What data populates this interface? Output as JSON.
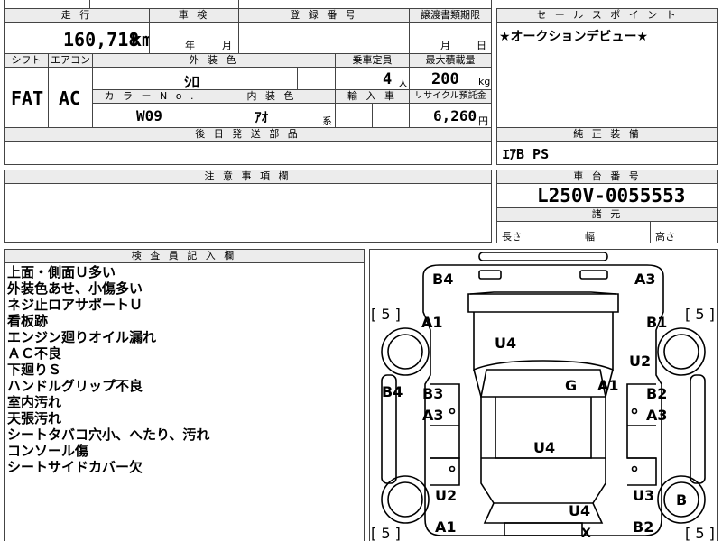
{
  "header": {
    "mileage_label": "走 行",
    "inspection_label": "車 検",
    "registration_label": "登 録 番 号",
    "transfer_docs_label": "譲渡書類期限",
    "sales_point_label": "セ ー ル ス ポ イ ン ト"
  },
  "mileage": {
    "value": "160,718",
    "unit": "km"
  },
  "inspection": {
    "year_label": "年",
    "month_label": "月"
  },
  "transfer": {
    "month_label": "月",
    "day_label": "日"
  },
  "sales_point": {
    "text": "★オークションデビュー★"
  },
  "labels": {
    "shift": "シフト",
    "aircon": "エアコン",
    "exterior_color": "外 装 色",
    "capacity": "乗車定員",
    "max_load": "最大積載量",
    "color_no": "カ ラ ー N o .",
    "interior_color": "内 装 色",
    "import": "輸 入 車",
    "recycle": "リサイクル預託金",
    "later_parts": "後 日 発 送 部 品",
    "oem_equipment": "純 正 装 備",
    "notes": "注 意 事 項 欄",
    "chassis_no": "車 台 番 号",
    "dimensions": "諸 元",
    "length": "長さ",
    "width": "幅",
    "height": "高さ",
    "inspector_notes": "検 査 員 記 入 欄"
  },
  "vehicle": {
    "shift": "FAT",
    "aircon": "AC",
    "exterior_color": "ｼﾛ",
    "capacity": "4",
    "capacity_unit": "人",
    "max_load": "200",
    "max_load_unit": "kg",
    "color_no": "W09",
    "interior_color": "ｱｵ",
    "interior_suffix": "系",
    "recycle_fee": "6,260",
    "recycle_unit": "円",
    "oem_equipment": "ｴｱB PS",
    "chassis_no": "L250V-0055553"
  },
  "inspector_notes": [
    "上面・側面Ｕ多い",
    "外装色あせ、小傷多い",
    "ネジ止ロアサポートＵ",
    "看板跡",
    "エンジン廻りオイル漏れ",
    "ＡＣ不良",
    "下廻りＳ",
    "ハンドルグリップ不良",
    "室内汚れ",
    "天張汚れ",
    "シートタバコ穴小、へたり、汚れ",
    "コンソール傷",
    "シートサイドカバー欠"
  ],
  "diagram": {
    "marks": {
      "front_left_top": "B4",
      "front_right_top": "A3",
      "fl_fender": "A1",
      "fr_fender": "B1",
      "hood": "U4",
      "fr_fender_rear": "U2",
      "left_mirror": "B4",
      "left_front_door_b": "B3",
      "left_front_door_a": "A3",
      "windshield": "G",
      "right_pillar": "A1",
      "right_front_door_b": "B2",
      "right_front_door_a": "A3",
      "roof": "U4",
      "rl_fender": "U2",
      "rr_fender": "U3",
      "rr_wheel": "B",
      "rear": "U4",
      "rl_bottom": "A1",
      "rr_bottom": "B2",
      "tailgate": "X"
    },
    "tire_tread": [
      "5",
      "5",
      "5",
      "5"
    ]
  }
}
